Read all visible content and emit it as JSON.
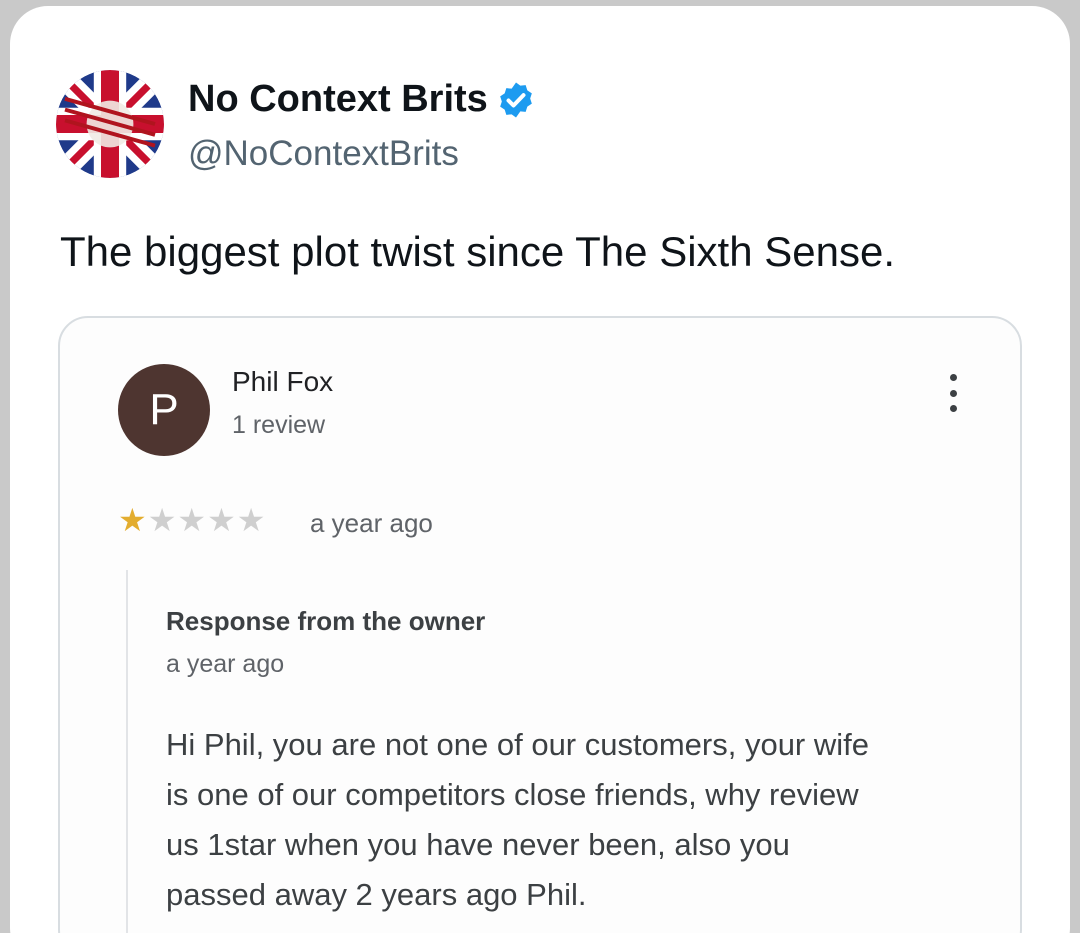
{
  "tweet": {
    "author": {
      "display_name": "No Context Brits",
      "handle": "@NoContextBrits",
      "verified": true,
      "verified_badge_color": "#1d9bf0",
      "avatar_icon": "union-jack-logo-icon",
      "avatar_text": "NO CONTEXT BRITS"
    },
    "text": "The biggest plot twist since The Sixth Sense."
  },
  "review": {
    "reviewer_initial": "P",
    "reviewer_avatar_color": "#4e3530",
    "reviewer_name": "Phil Fox",
    "review_count": "1 review",
    "rating": 1,
    "rating_max": 5,
    "star_filled_color": "#e3ad2f",
    "star_empty_color": "#cfcfcf",
    "date": "a year ago",
    "menu_icon": "more-vertical-icon",
    "owner_response": {
      "title": "Response from the owner",
      "date": "a year ago",
      "lines": [
        "Hi Phil, you are not one of our customers, your wife",
        "is one of our competitors close friends, why review",
        "us 1star when you have never been, also you",
        "passed away 2 years ago Phil."
      ]
    }
  }
}
